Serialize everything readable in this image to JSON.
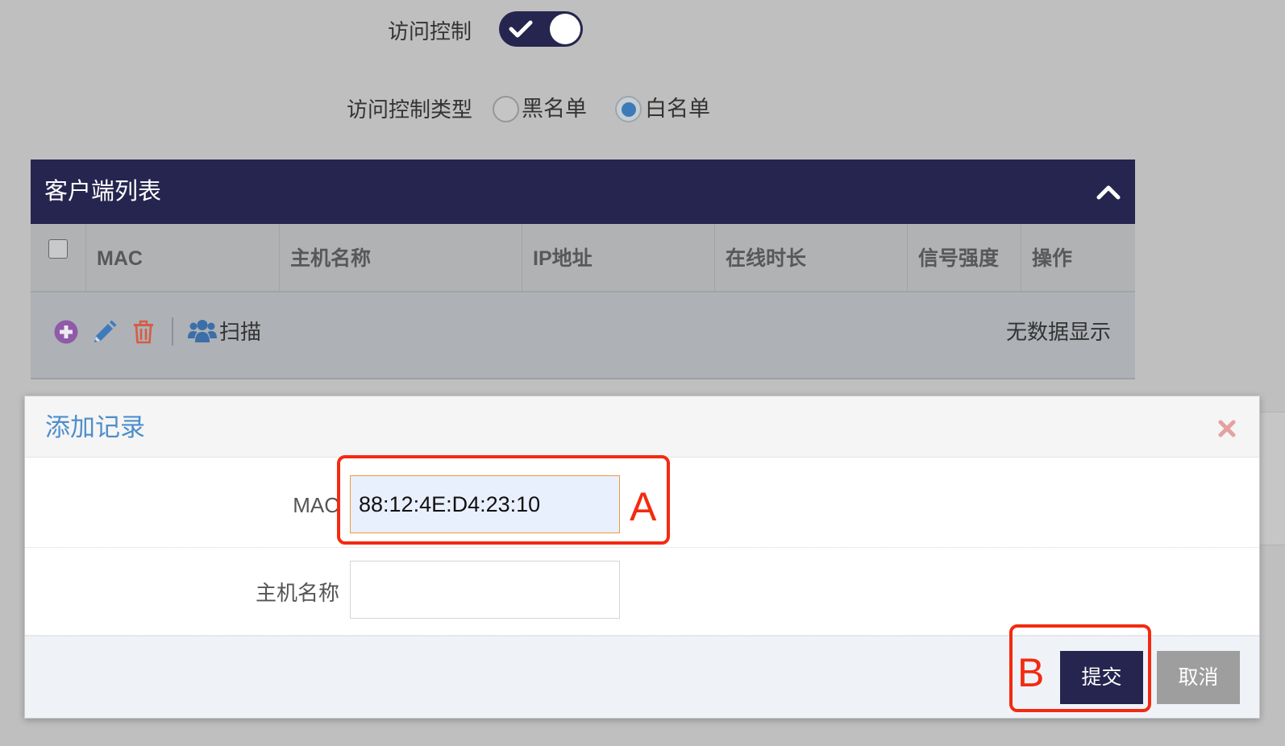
{
  "access_control": {
    "label": "访问控制",
    "toggle_on": true,
    "toggle_icon": "check-icon"
  },
  "access_control_type": {
    "label": "访问控制类型",
    "options": [
      {
        "label": "黑名单",
        "checked": false
      },
      {
        "label": "白名单",
        "checked": true
      }
    ]
  },
  "client_list": {
    "title": "客户端列表",
    "collapse_icon": "chevron-up-icon",
    "select_all_checked": false,
    "columns": [
      "MAC",
      "主机名称",
      "IP地址",
      "在线时长",
      "信号强度",
      "操作"
    ],
    "toolbar": {
      "add_icon": "plus-circle-icon",
      "edit_icon": "pencil-icon",
      "delete_icon": "trash-icon",
      "scan_icon": "users-icon",
      "scan_label": "扫描"
    },
    "empty_text": "无数据显示"
  },
  "dialog": {
    "title": "添加记录",
    "close_icon": "close-icon",
    "fields": [
      {
        "label": "MAC",
        "value": "88:12:4E:D4:23:10"
      },
      {
        "label": "主机名称",
        "value": ""
      }
    ],
    "submit_label": "提交",
    "cancel_label": "取消"
  },
  "annotations": {
    "a": {
      "label": "A"
    },
    "b": {
      "label": "B"
    }
  },
  "colors": {
    "navy": "#26254f",
    "accent": "#4e8fca",
    "annotation_red": "#f42a10",
    "add_icon": "#8f5aa8",
    "edit_icon": "#3f7bbb",
    "delete_icon": "#d35d46",
    "scan_icon": "#3b6fa8",
    "close_icon": "#e3a1a1",
    "radio_checked": "#3b7cb8",
    "cancel_button": "#9e9e9e",
    "autofill_bg": "#e8f0fe",
    "focus_border": "#f0993e"
  }
}
